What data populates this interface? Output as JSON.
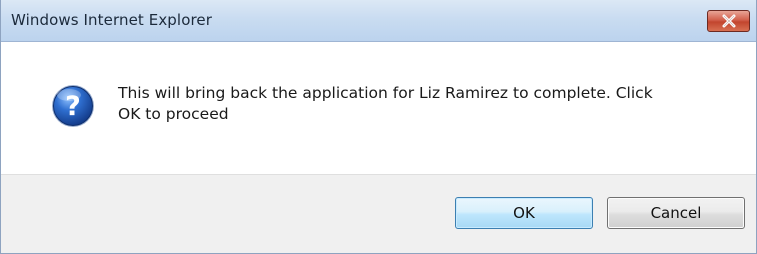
{
  "window": {
    "title": "Windows Internet Explorer"
  },
  "dialog": {
    "icon": "question-icon",
    "message_line1": "This will bring back the application for Liz Ramirez to complete. Click",
    "message_line2": "OK to proceed"
  },
  "buttons": {
    "ok_label": "OK",
    "cancel_label": "Cancel"
  },
  "colors": {
    "titlebar": "#c9dcf1",
    "close_button": "#c2452e",
    "ok_border": "#3c7fb1",
    "icon_blue": "#1f5fbf"
  }
}
